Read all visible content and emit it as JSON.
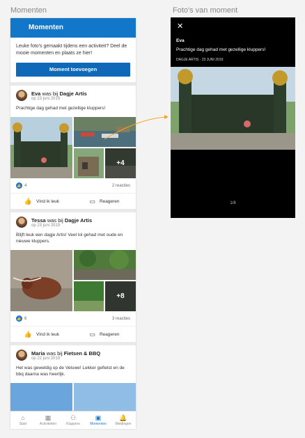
{
  "labels": {
    "left": "Momenten",
    "right": "Foto's van moment"
  },
  "appbar": {
    "title": "Momenten"
  },
  "intro": {
    "text": "Leuke foto's gemaakt tijdens een activiteit? Deel de mooie momenten en plaats ze hier!",
    "button": "Moment toevoegen"
  },
  "posts": [
    {
      "name": "Eva",
      "was_bij": "was bij",
      "place": "Dagje Artis",
      "date": "op 23 juni 2019",
      "text": "Prachtige dag gehad met gezellige kluppers!",
      "more": "+4",
      "likes": "4",
      "reacties": "2 reacties"
    },
    {
      "name": "Tessa",
      "was_bij": "was bij",
      "place": "Dagje Artis",
      "date": "op 23 juni 2019",
      "text": "Blijft leuk een dagje Artis! Veel lol gehad met oude en nieuwe kluppers.",
      "more": "+8",
      "likes": "6",
      "reacties": "3 reacties"
    },
    {
      "name": "Maria",
      "was_bij": "was bij",
      "place": "Fietsen & BBQ",
      "date": "op 22 juni 2019",
      "text": "Het was geweldig op de Veluwe! Lekker gefietst en de bbq daarna was heerlijk."
    }
  ],
  "actions": {
    "like": "Vind ik leuk",
    "reply": "Reageren"
  },
  "nav": [
    "Start",
    "Activiteiten",
    "Kluppers",
    "Momenten",
    "Meldingen"
  ],
  "nav_active": "Momenten",
  "icons": {
    "close": "close-icon",
    "like": "thumbs-up-icon",
    "reply": "comment-icon"
  },
  "colors": {
    "accent": "#1377c9",
    "button": "#1068b8",
    "arrow": "#f5a623"
  },
  "viewer": {
    "close": "✕",
    "name": "Eva",
    "text": "Prachtige dag gehad met gezellige kluppers!",
    "meta": "DAGJE ARTIS · 23 JUNI 2019",
    "count": "1/8"
  }
}
